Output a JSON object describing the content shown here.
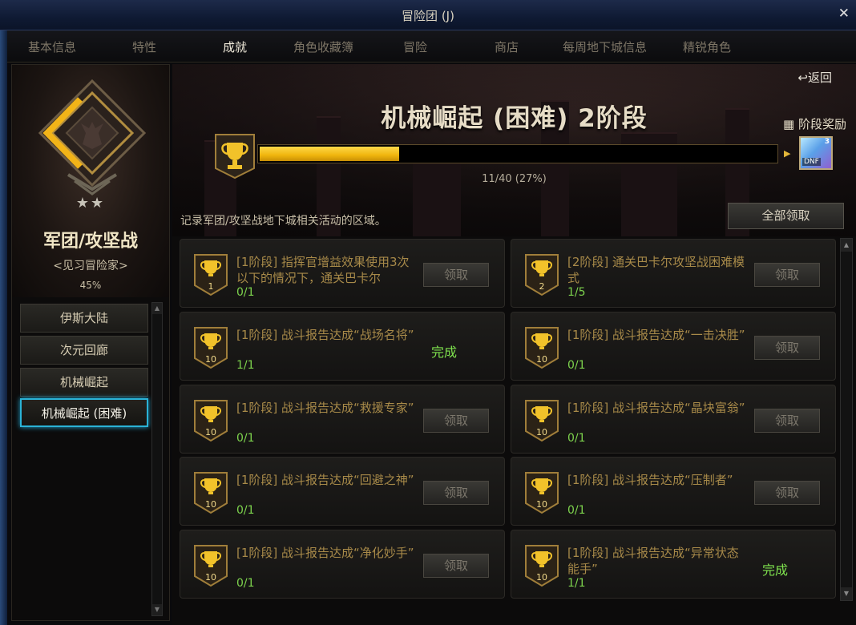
{
  "window": {
    "title": "冒险团 (J)",
    "close_icon": "close-icon"
  },
  "tabs": [
    {
      "label": "基本信息",
      "active": false
    },
    {
      "label": "特性",
      "active": false
    },
    {
      "label": "成就",
      "active": true
    },
    {
      "label": "角色收藏簿",
      "active": false
    },
    {
      "label": "冒险",
      "active": false
    },
    {
      "label": "商店",
      "active": false
    },
    {
      "label": "每周地下城信息",
      "active": false
    },
    {
      "label": "精锐角色",
      "active": false
    }
  ],
  "rank": {
    "stars": "★★",
    "name": "军团/攻坚战",
    "title": "<见习冒险家>",
    "percent": "45%"
  },
  "dungeons": [
    {
      "label": "伊斯大陆",
      "selected": false
    },
    {
      "label": "次元回廊",
      "selected": false
    },
    {
      "label": "机械崛起",
      "selected": false
    },
    {
      "label": "机械崛起 (困难)",
      "selected": true
    }
  ],
  "stage": {
    "return_label": "返回",
    "title": "机械崛起 (困难) 2阶段",
    "reward_label": "阶段奖励",
    "progress_text": "11/40 (27%)",
    "progress_fraction": 0.27,
    "reward_count": "3",
    "reward_item_label": "DNF"
  },
  "description": "记录军团/攻坚战地下城相关活动的区域。",
  "claim_all_label": "全部领取",
  "claim_label": "领取",
  "done_label": "完成",
  "achievements": [
    {
      "name": "[1阶段] 指挥官增益效果使用3次以下的情况下，通关巴卡尔",
      "badge": "1",
      "progress": "0/1",
      "done": false
    },
    {
      "name": "[2阶段] 通关巴卡尔攻坚战困难模式",
      "badge": "2",
      "progress": "1/5",
      "done": false
    },
    {
      "name": "[1阶段] 战斗报告达成“战场名将”",
      "badge": "10",
      "progress": "1/1",
      "done": true
    },
    {
      "name": "[1阶段] 战斗报告达成“一击决胜”",
      "badge": "10",
      "progress": "0/1",
      "done": false
    },
    {
      "name": "[1阶段] 战斗报告达成“救援专家”",
      "badge": "10",
      "progress": "0/1",
      "done": false
    },
    {
      "name": "[1阶段] 战斗报告达成“晶块富翁”",
      "badge": "10",
      "progress": "0/1",
      "done": false
    },
    {
      "name": "[1阶段] 战斗报告达成“回避之神”",
      "badge": "10",
      "progress": "0/1",
      "done": false
    },
    {
      "name": "[1阶段] 战斗报告达成“压制者”",
      "badge": "10",
      "progress": "0/1",
      "done": false
    },
    {
      "name": "[1阶段] 战斗报告达成“净化妙手”",
      "badge": "10",
      "progress": "0/1",
      "done": false
    },
    {
      "name": "[1阶段] 战斗报告达成“异常状态能手”",
      "badge": "10",
      "progress": "1/1",
      "done": true
    }
  ],
  "colors": {
    "accent_gold": "#f0b50d",
    "selected_border": "#2ab2d6",
    "progress_green": "#7dd34d"
  }
}
